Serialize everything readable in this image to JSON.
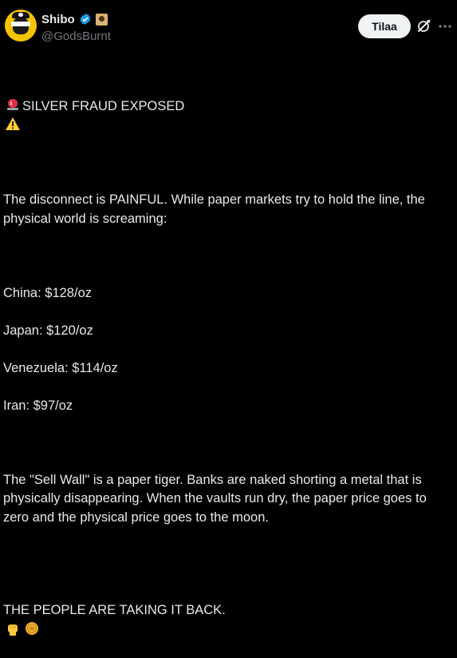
{
  "author": {
    "display_name": "Shibo",
    "handle": "@GodsBurnt"
  },
  "actions": {
    "follow_label": "Tilaa"
  },
  "icons": {
    "verified": "verified-badge-icon",
    "grok": "grok-icon",
    "more": "more-options-icon",
    "siren": "police-light-emoji",
    "warning": "warning-emoji",
    "fist": "raised-fist-emoji",
    "coin": "coin-emoji"
  },
  "colors": {
    "background": "#000000",
    "text": "#e7e9ea",
    "muted": "#71767b",
    "verified": "#1d9bf0",
    "button_bg": "#eff3f4"
  },
  "post": {
    "title": "SILVER FRAUD EXPOSED",
    "intro": "The disconnect is PAINFUL. While paper markets try to hold the line, the physical world is screaming:",
    "prices": [
      "China: $128/oz",
      "Japan: $120/oz",
      "Venezuela: $114/oz",
      "Iran: $97/oz"
    ],
    "body": "The \"Sell Wall\" is a paper tiger. Banks are naked shorting a metal that is physically disappearing. When the vaults run dry, the paper price goes to zero and the physical price goes to the moon.",
    "closing": "THE PEOPLE ARE TAKING IT BACK."
  }
}
